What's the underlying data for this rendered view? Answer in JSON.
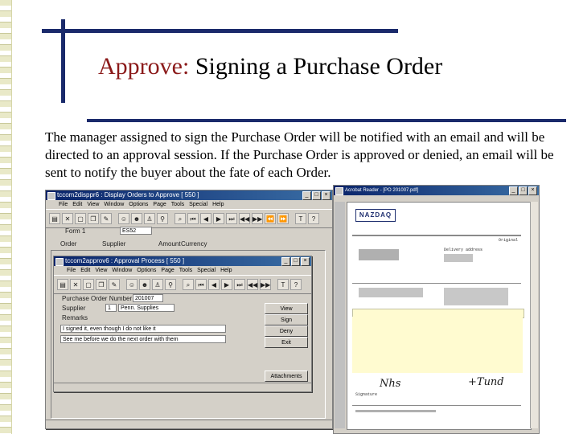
{
  "slide": {
    "title_highlight": "Approve:",
    "title_rest": " Signing a Purchase Order",
    "body": "The manager assigned to sign the Purchase Order will be notified with an email and will be directed to an approval session. If the Purchase Order is approved or denied, an email will be sent to notify the buyer about the fate of each Order."
  },
  "window1": {
    "title": "tccom2disppr6 : Display Orders to Approve [ 550 ]",
    "menus": [
      "File",
      "Edit",
      "View",
      "Window",
      "Options",
      "Page",
      "Tools",
      "Special",
      "Help"
    ],
    "field_label": "Form 1",
    "field_value": "ES52",
    "columns": [
      "Order",
      "Supplier",
      "Amount",
      "Currency"
    ]
  },
  "window2": {
    "title": "tccom2approv6 : Approval Process [ 550 ]",
    "menus": [
      "File",
      "Edit",
      "View",
      "Window",
      "Options",
      "Page",
      "Tools",
      "Special",
      "Help"
    ],
    "po_label": "Purchase Order Number",
    "po_value": "201007",
    "supplier_label": "Supplier",
    "supplier_value": "1",
    "supplier_name": "Penn. Supplies",
    "remarks_label": "Remarks",
    "remark1": "I signed it, even though I do not like it",
    "remark2": "See me before we do the next order with them",
    "buttons": {
      "view": "View",
      "sign": "Sign",
      "deny": "Deny",
      "exit": "Exit"
    },
    "attachments": "Attachments"
  },
  "document": {
    "logo": "NAZDAQ",
    "title_bar": "Acrobat Reader - [PO 201007.pdf]",
    "original": "Original",
    "delivery": "Delivery address",
    "sig_text": "Signature"
  }
}
